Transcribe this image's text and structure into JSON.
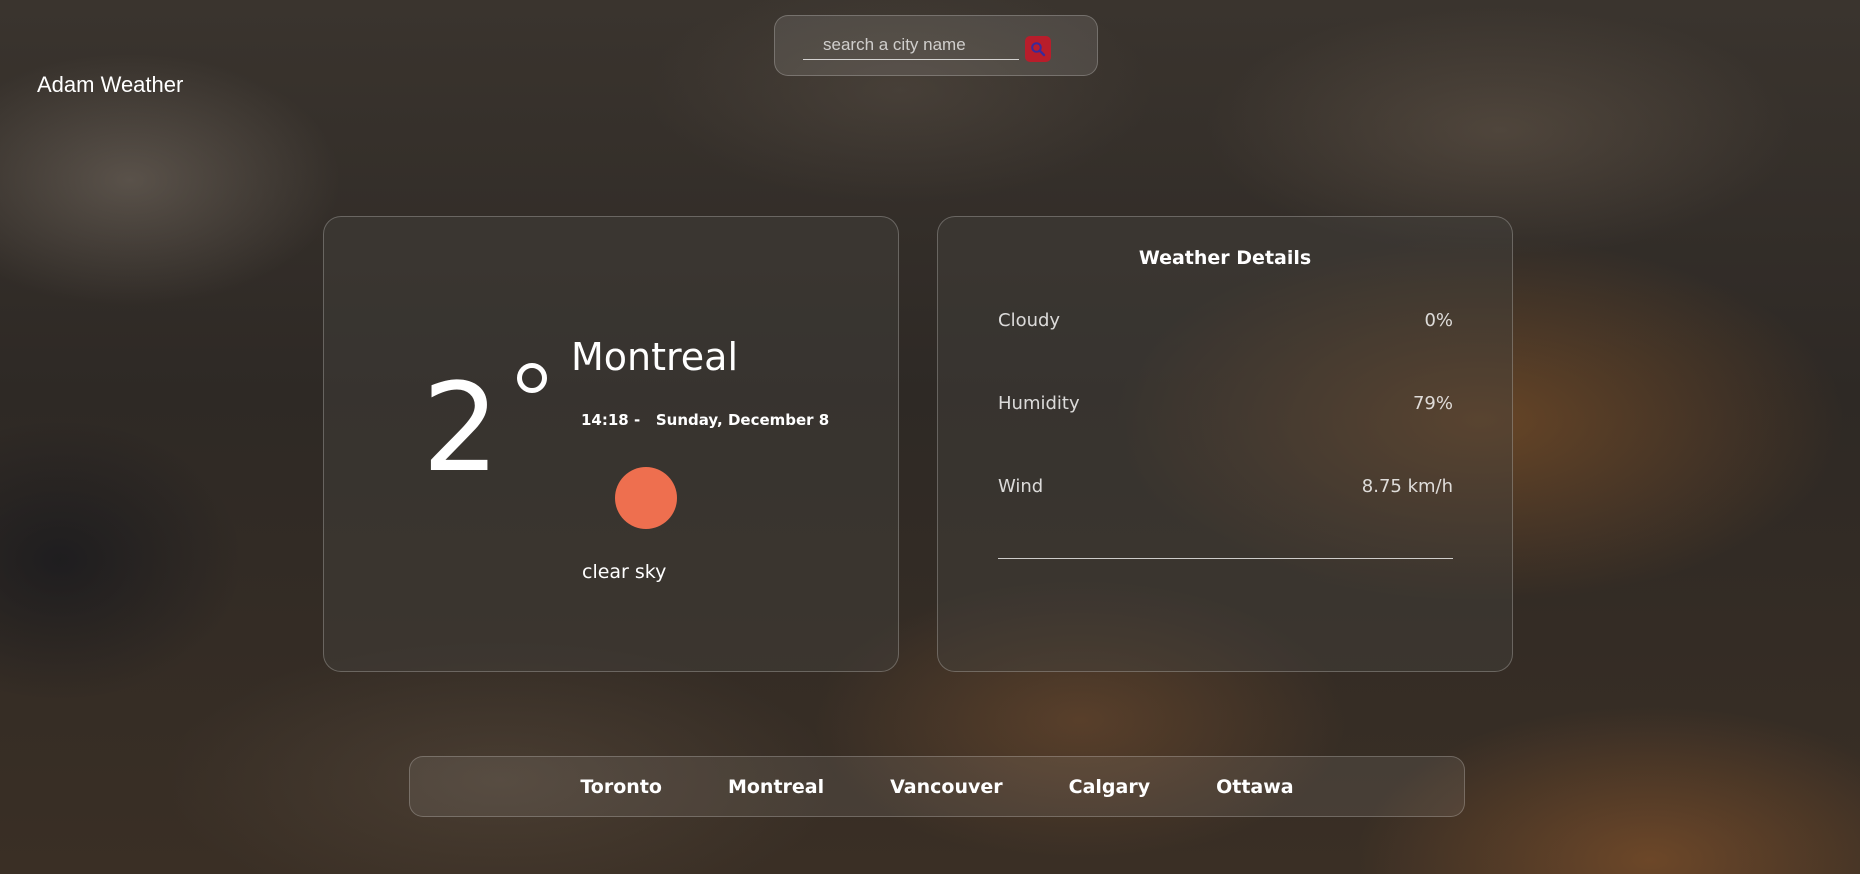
{
  "app": {
    "brand": "Adam Weather"
  },
  "search": {
    "placeholder": "search a city name",
    "value": "",
    "button_icon": "search-icon",
    "button_color": "#b81d2b"
  },
  "current": {
    "temperature": "2",
    "city": "Montreal",
    "time": "14:18",
    "date": "Sunday, December 8",
    "datetime_text": "14:18 -   Sunday, December 8",
    "condition_icon": "sun-icon",
    "condition_color": "#ee6f4f",
    "description": "clear sky"
  },
  "details": {
    "title": "Weather Details",
    "rows": [
      {
        "label": "Cloudy",
        "value": "0%"
      },
      {
        "label": "Humidity",
        "value": "79%"
      },
      {
        "label": "Wind",
        "value": "8.75 km/h"
      }
    ]
  },
  "cities": [
    "Toronto",
    "Montreal",
    "Vancouver",
    "Calgary",
    "Ottawa"
  ]
}
